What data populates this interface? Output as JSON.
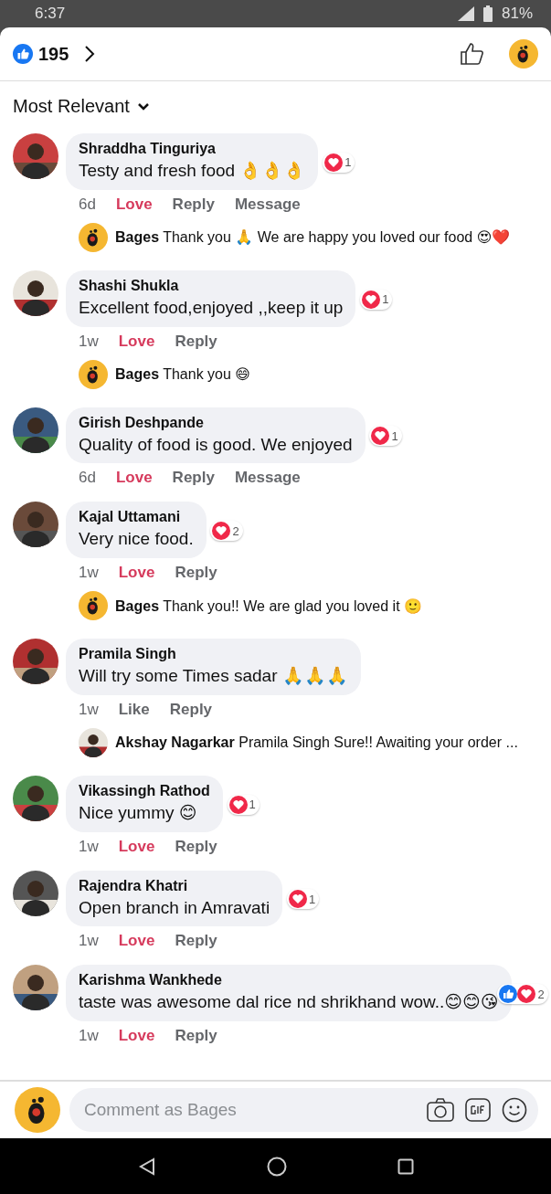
{
  "status_bar": {
    "time": "6:37",
    "battery": "81%"
  },
  "header": {
    "reaction_count": "195"
  },
  "sort": {
    "label": "Most Relevant"
  },
  "comments": [
    {
      "author": "Shraddha Tinguriya",
      "text": "Testy and fresh food 👌👌👌",
      "reactions": [
        {
          "kind": "love"
        }
      ],
      "reaction_count": "1",
      "time": "6d",
      "reaction_label": "Love",
      "reacted": true,
      "actions": [
        "Reply",
        "Message"
      ],
      "replies": [
        {
          "kind": "logo",
          "author": "Bages",
          "text": "Thank you 🙏 We are happy you loved our food 😍❤️"
        }
      ]
    },
    {
      "author": "Shashi Shukla",
      "text": "Excellent food,enjoyed ,,keep it up",
      "reactions": [
        {
          "kind": "love"
        }
      ],
      "reaction_count": "1",
      "time": "1w",
      "reaction_label": "Love",
      "reacted": true,
      "actions": [
        "Reply"
      ],
      "replies": [
        {
          "kind": "logo",
          "author": "Bages",
          "text": "Thank you 😄"
        }
      ]
    },
    {
      "author": "Girish Deshpande",
      "text": "Quality of food is good.  We enjoyed",
      "reactions": [
        {
          "kind": "love"
        }
      ],
      "reaction_count": "1",
      "time": "6d",
      "reaction_label": "Love",
      "reacted": true,
      "actions": [
        "Reply",
        "Message"
      ]
    },
    {
      "author": "Kajal Uttamani",
      "text": "Very nice food.",
      "reactions": [
        {
          "kind": "love"
        }
      ],
      "reaction_count": "2",
      "time": "1w",
      "reaction_label": "Love",
      "reacted": true,
      "actions": [
        "Reply"
      ],
      "replies": [
        {
          "kind": "logo",
          "author": "Bages",
          "text": "Thank you!! We are glad you loved it 🙂"
        }
      ]
    },
    {
      "author": "Pramila Singh",
      "text": "Will try some Times sadar 🙏🙏🙏",
      "time": "1w",
      "reaction_label": "Like",
      "reacted": false,
      "actions": [
        "Reply"
      ],
      "replies": [
        {
          "kind": "picture",
          "author": "Akshay Nagarkar",
          "text": "Pramila Singh Sure!! Awaiting your order ..."
        }
      ]
    },
    {
      "author": "Vikassingh Rathod",
      "text": "Nice yummy 😊",
      "reactions": [
        {
          "kind": "love"
        }
      ],
      "reaction_count": "1",
      "time": "1w",
      "reaction_label": "Love",
      "reacted": true,
      "actions": [
        "Reply"
      ]
    },
    {
      "author": "Rajendra Khatri",
      "text": "Open branch in Amravati",
      "reactions": [
        {
          "kind": "love"
        }
      ],
      "reaction_count": "1",
      "time": "1w",
      "reaction_label": "Love",
      "reacted": true,
      "actions": [
        "Reply"
      ]
    },
    {
      "author": "Karishma Wankhede",
      "text": "taste was awesome dal rice nd shrikhand wow..😊😊😘",
      "reactions": [
        {
          "kind": "like"
        },
        {
          "kind": "love"
        }
      ],
      "reaction_count": "2",
      "time": "1w",
      "reaction_label": "Love",
      "reacted": true,
      "actions": [
        "Reply"
      ]
    }
  ],
  "composer": {
    "placeholder": "Comment as Bages"
  }
}
